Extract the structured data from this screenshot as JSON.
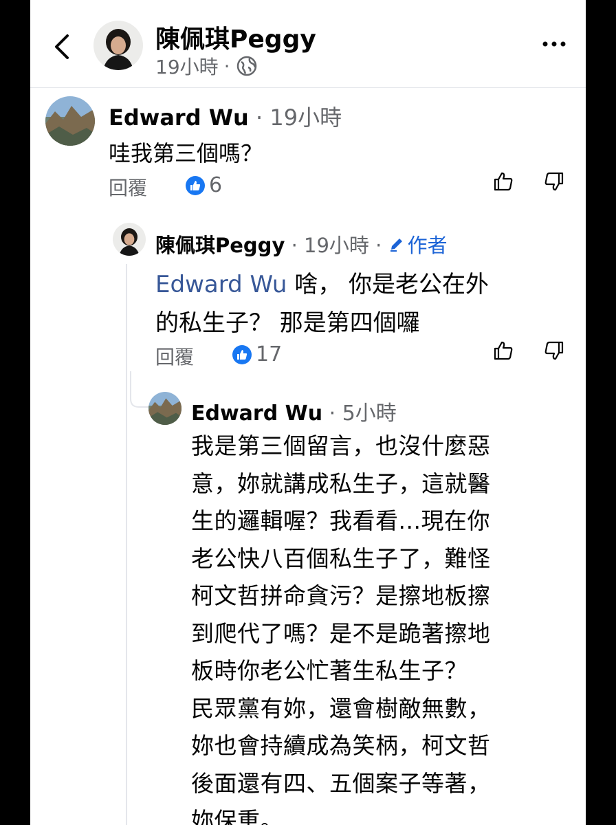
{
  "header": {
    "name": "陳佩琪Peggy",
    "time": "19小時",
    "dot": "·"
  },
  "comments": [
    {
      "author": "Edward Wu",
      "time": "19小時",
      "text": "哇我第三個嗎？",
      "reply_label": "回覆",
      "likes": "6"
    },
    {
      "author": "陳佩琪Peggy",
      "time": "19小時",
      "author_badge": "作者",
      "mention": "Edward Wu",
      "text_line1": " 啥，  你是老公在外",
      "text_line2": "的私生子？  那是第四個囉",
      "reply_label": "回覆",
      "likes": "17"
    },
    {
      "author": "Edward Wu",
      "time": "5小時",
      "lines": [
        "我是第三個留言，也沒什麼惡",
        "意，妳就講成私生子，這就醫",
        "生的邏輯喔？我看看...現在你",
        "老公快八百個私生子了，難怪",
        "柯文哲拼命貪污？是擦地板擦",
        "到爬代了嗎？是不是跪著擦地",
        "板時你老公忙著生私生子？",
        "民眾黨有妳，還會樹敵無數，",
        "妳也會持續成為笑柄，柯文哲",
        "後面還有四、五個案子等著，",
        "妳保重。"
      ]
    }
  ],
  "icons": {
    "back": "chevron-left-icon",
    "globe": "globe-icon",
    "more": "more-icon",
    "like": "thumbs-up-icon",
    "dislike": "thumbs-down-icon",
    "edit": "pencil-icon"
  },
  "colors": {
    "like_blue": "#1877f2",
    "mention": "#385898",
    "author_badge": "#1b63d6",
    "meta_gray": "#65676b"
  }
}
